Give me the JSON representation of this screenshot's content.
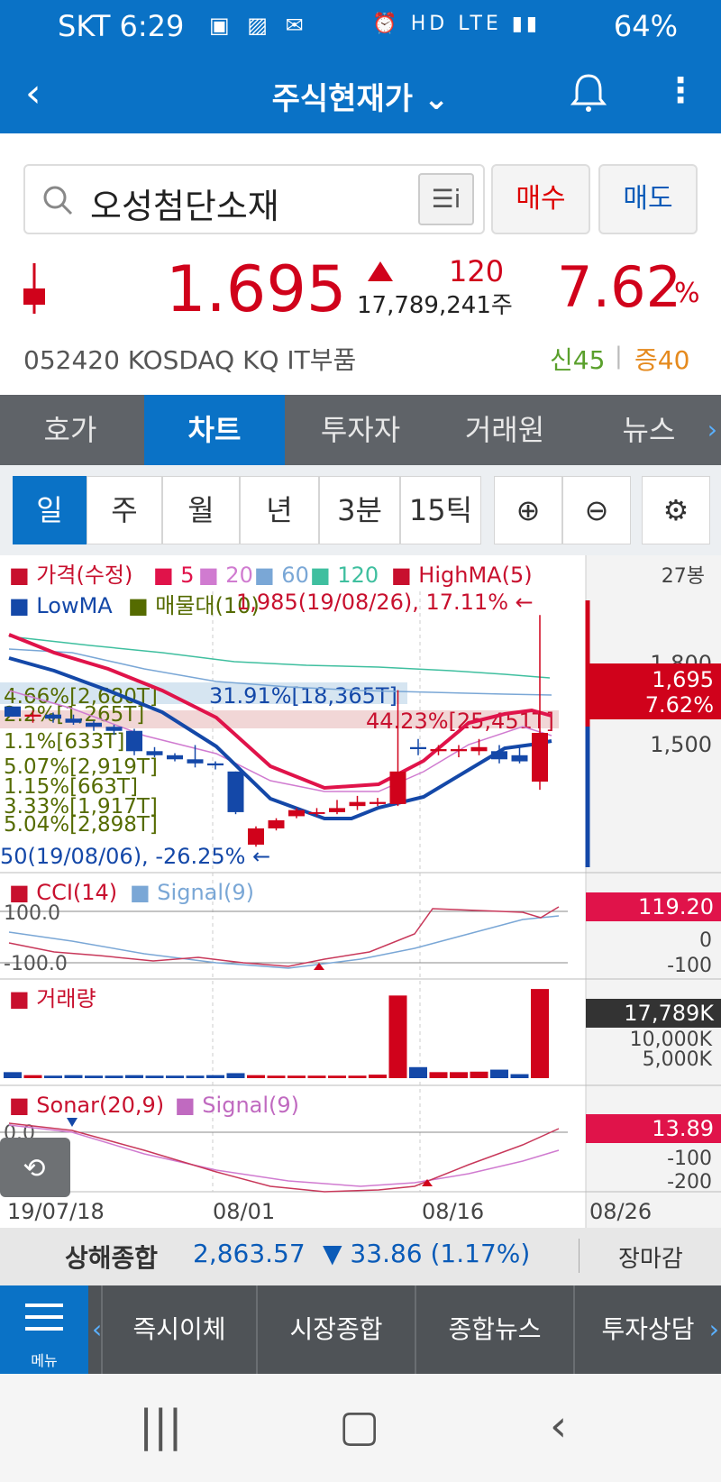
{
  "status": {
    "carrier_time": "SKT 6:29",
    "battery": "64%"
  },
  "appbar": {
    "title": "주식현재가 ⌄"
  },
  "search": {
    "value": "오성첨단소재"
  },
  "buttons": {
    "buy": "매수",
    "sell": "매도"
  },
  "quote": {
    "price": "1.695",
    "change": "120",
    "volume": "17,789,241주",
    "percent": "7.62",
    "percent_unit": "%",
    "code_market": "052420  KOSDAQ  KQ IT부품",
    "shin": "신45",
    "separator": "|",
    "jeung": "증40"
  },
  "tabs": [
    "호가",
    "차트",
    "투자자",
    "거래원",
    "뉴스"
  ],
  "periods": [
    "일",
    "주",
    "월",
    "년",
    "3분",
    "15틱"
  ],
  "chart": {
    "legend1": [
      "■ 가격(수정)",
      "■ 5",
      "■ 20",
      "■ 60",
      "■ 120",
      "■ HighMA(5)"
    ],
    "legend2": [
      "■ LowMA",
      "■ 매물대(10)"
    ],
    "count": "27봉",
    "high_note": "1,985(19/08/26), 17.11% ←",
    "low_note": "50(19/08/06), -26.25% ←",
    "vp_labels": [
      "4.66%[2,680T]",
      "2.2%[1,265T]",
      "1.1%[633T]",
      "5.07%[2,919T]",
      "1.15%[663T]",
      "3.33%[1,917T]",
      "5.04%[2,898T]"
    ],
    "band1": "31.91%[18,365T]",
    "band2": "44.23%[25,451T]",
    "price_ticks": [
      "1,800",
      "1,500"
    ],
    "cur_price": "1,695",
    "cur_pct": "7.62%",
    "cci_legend": [
      "■ CCI(14)",
      "■ Signal(9)"
    ],
    "cci_levels": [
      "100.0",
      "-100.0"
    ],
    "cci_ticks": [
      "0",
      "-100"
    ],
    "cci_cur": "119.20",
    "vol_legend": "■ 거래량",
    "vol_cur": "17,789K",
    "vol_ticks": [
      "10,000K",
      "5,000K"
    ],
    "sonar_legend": [
      "■ Sonar(20,9)",
      "■ Signal(9)"
    ],
    "sonar_levels": [
      "0.0"
    ],
    "sonar_ticks": [
      "-100",
      "-200"
    ],
    "sonar_cur": "13.89",
    "dates": [
      "19/07/18",
      "08/01",
      "08/16",
      "08/26"
    ],
    "colors": {
      "up": "#d0021b",
      "down": "#1448a8",
      "ma5": "#e0134a",
      "ma20": "#d07bd0",
      "ma60": "#7aa7d6",
      "ma120": "#3fbf9f"
    },
    "candles": [
      {
        "o": 1760,
        "c": 1735,
        "h": 1760,
        "l": 1735
      },
      {
        "o": 1735,
        "c": 1740,
        "h": 1750,
        "l": 1720
      },
      {
        "o": 1740,
        "c": 1730,
        "h": 1745,
        "l": 1720
      },
      {
        "o": 1730,
        "c": 1720,
        "h": 1740,
        "l": 1715
      },
      {
        "o": 1720,
        "c": 1710,
        "h": 1725,
        "l": 1700
      },
      {
        "o": 1710,
        "c": 1700,
        "h": 1715,
        "l": 1690
      },
      {
        "o": 1700,
        "c": 1650,
        "h": 1705,
        "l": 1640
      },
      {
        "o": 1650,
        "c": 1640,
        "h": 1660,
        "l": 1635
      },
      {
        "o": 1640,
        "c": 1630,
        "h": 1645,
        "l": 1625
      },
      {
        "o": 1630,
        "c": 1620,
        "h": 1665,
        "l": 1610
      },
      {
        "o": 1620,
        "c": 1615,
        "h": 1625,
        "l": 1605
      },
      {
        "o": 1600,
        "c": 1500,
        "h": 1600,
        "l": 1495
      },
      {
        "o": 1420,
        "c": 1460,
        "h": 1465,
        "l": 1415
      },
      {
        "o": 1460,
        "c": 1480,
        "h": 1485,
        "l": 1455
      },
      {
        "o": 1490,
        "c": 1505,
        "h": 1510,
        "l": 1485
      },
      {
        "o": 1500,
        "c": 1500,
        "h": 1510,
        "l": 1490
      },
      {
        "o": 1500,
        "c": 1510,
        "h": 1530,
        "l": 1495
      },
      {
        "o": 1515,
        "c": 1525,
        "h": 1540,
        "l": 1505
      },
      {
        "o": 1520,
        "c": 1525,
        "h": 1535,
        "l": 1515
      },
      {
        "o": 1520,
        "c": 1600,
        "h": 1800,
        "l": 1515
      },
      {
        "o": 1660,
        "c": 1655,
        "h": 1680,
        "l": 1640
      },
      {
        "o": 1650,
        "c": 1655,
        "h": 1665,
        "l": 1640
      },
      {
        "o": 1650,
        "c": 1655,
        "h": 1665,
        "l": 1635
      },
      {
        "o": 1650,
        "c": 1660,
        "h": 1680,
        "l": 1640
      },
      {
        "o": 1650,
        "c": 1630,
        "h": 1665,
        "l": 1620
      },
      {
        "o": 1640,
        "c": 1625,
        "h": 1665,
        "l": 1620
      },
      {
        "o": 1575,
        "c": 1695,
        "h": 1985,
        "l": 1555
      }
    ],
    "volumes": [
      1.2,
      0.6,
      0.5,
      0.6,
      0.5,
      0.5,
      0.6,
      0.5,
      0.5,
      0.5,
      0.6,
      1.0,
      0.6,
      0.5,
      0.5,
      0.5,
      0.5,
      0.5,
      0.7,
      16.5,
      2.2,
      1.2,
      1.2,
      1.3,
      1.7,
      0.8,
      17.8
    ]
  },
  "index_bar": {
    "name": "상해종합",
    "value": "2,863.57",
    "change": "▼ 33.86 (1.17%)",
    "close": "장마감"
  },
  "bottom_menu": {
    "menu_label": "메뉴",
    "items": [
      "즉시이체",
      "시장종합",
      "종합뉴스",
      "투자상담"
    ]
  }
}
